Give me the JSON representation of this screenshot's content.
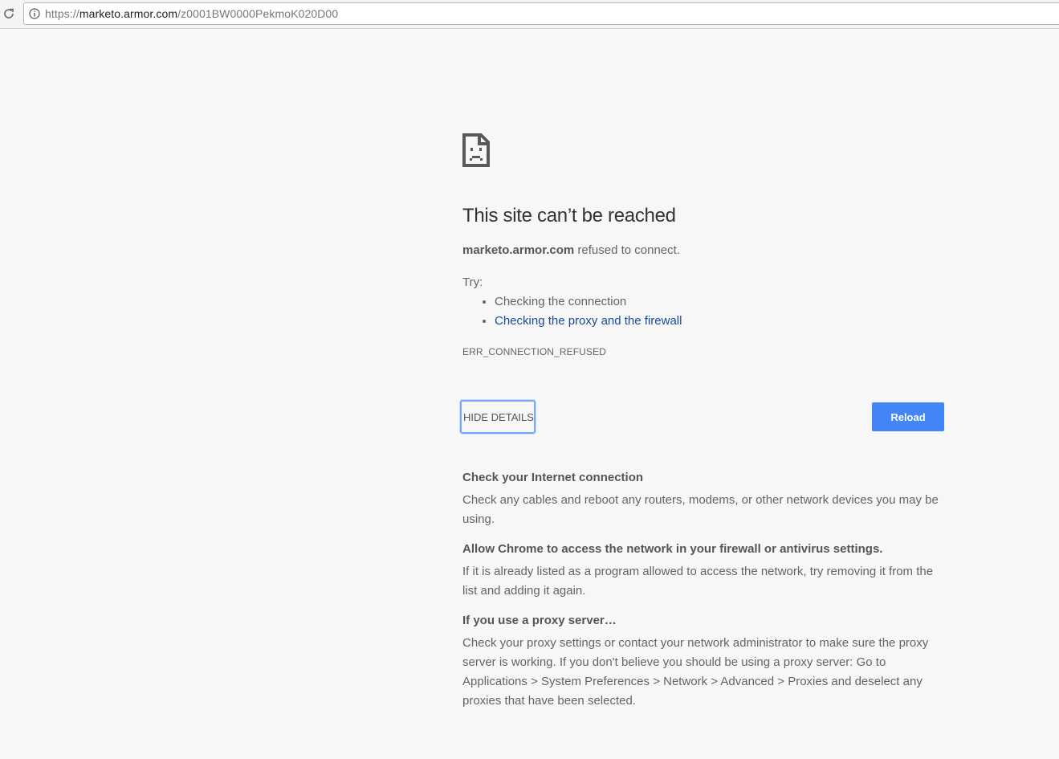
{
  "browser": {
    "url": {
      "scheme": "https://",
      "host": "marketo.armor.com",
      "path": "/z0001BW0000PekmoK020D00"
    }
  },
  "error_page": {
    "heading": "This site can’t be reached",
    "host": "marketo.armor.com",
    "summary_suffix": " refused to connect.",
    "try_label": "Try:",
    "suggestions": [
      {
        "text": "Checking the connection",
        "link": false
      },
      {
        "text": "Checking the proxy and the firewall",
        "link": true
      }
    ],
    "error_code": "ERR_CONNECTION_REFUSED",
    "details_button": "HIDE DETAILS",
    "reload_button": "Reload",
    "details": [
      {
        "heading": "Check your Internet connection",
        "text": "Check any cables and reboot any routers, modems, or other network devices you may be using."
      },
      {
        "heading": "Allow Chrome to access the network in your firewall or antivirus settings.",
        "text": "If it is already listed as a program allowed to access the network, try removing it from the list and adding it again."
      },
      {
        "heading": "If you use a proxy server…",
        "text": "Check your proxy settings or contact your network administrator to make sure the proxy server is working. If you don't believe you should be using a proxy server: Go to Applications > System Preferences > Network > Advanced > Proxies and deselect any proxies that have been selected."
      }
    ]
  },
  "colors": {
    "accent": "#4285f4",
    "link": "#1a4a9c",
    "focus_ring": "#77a7f7",
    "background": "#f7f7f7"
  },
  "icons": [
    "reload-icon",
    "info-icon",
    "sad-page-icon"
  ]
}
